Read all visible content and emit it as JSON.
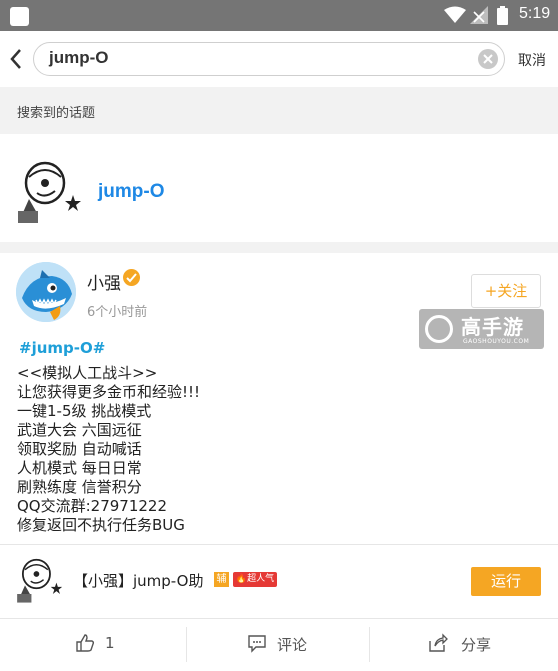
{
  "status_bar": {
    "time": "5:19"
  },
  "search": {
    "query": "jump-O",
    "cancel_label": "取消"
  },
  "section": {
    "label": "搜索到的话题"
  },
  "topic": {
    "name": "jump-O"
  },
  "post": {
    "username": "小强",
    "time": "6个小时前",
    "follow_label": "+关注",
    "hashtag": "#jump-O#",
    "lines": [
      "<<模拟人工战斗>>",
      "让您获得更多金币和经验!!!",
      "一键1-5级 挑战模式",
      "武道大会 六国远征",
      "领取奖励 自动喊话",
      "人机模式 每日日常",
      "刷熟练度 信誉积分",
      "QQ交流群:27971222",
      "修复返回不执行任务BUG"
    ]
  },
  "watermark": {
    "title": "高手游",
    "subtitle": "GAOSHOUYOU.COM"
  },
  "app": {
    "name": "【小强】jump-O助",
    "tag_assist": "辅",
    "tag_hot": "超人气",
    "run_label": "运行"
  },
  "actions": {
    "like_count": "1",
    "comment_label": "评论",
    "share_label": "分享"
  },
  "colors": {
    "accent": "#f5a623",
    "link": "#1e88e5",
    "hot": "#e53935"
  }
}
